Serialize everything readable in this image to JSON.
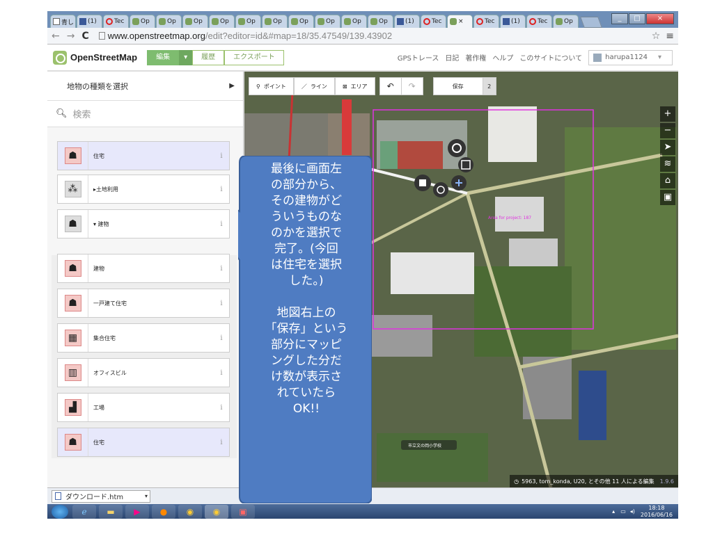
{
  "browser": {
    "tabs": [
      {
        "label": "青し",
        "icon": "doc"
      },
      {
        "label": "(1)",
        "icon": "fb"
      },
      {
        "label": "Tec",
        "icon": "red"
      },
      {
        "label": "Op",
        "icon": "osm"
      },
      {
        "label": "Op",
        "icon": "osm"
      },
      {
        "label": "Op",
        "icon": "osm"
      },
      {
        "label": "Op",
        "icon": "osm"
      },
      {
        "label": "Op",
        "icon": "osm"
      },
      {
        "label": "Op",
        "icon": "osm"
      },
      {
        "label": "Op",
        "icon": "osm"
      },
      {
        "label": "Op",
        "icon": "osm"
      },
      {
        "label": "Op",
        "icon": "osm"
      },
      {
        "label": "Op",
        "icon": "osm"
      },
      {
        "label": "(1)",
        "icon": "fb"
      },
      {
        "label": "Tec",
        "icon": "red"
      },
      {
        "label": "× ",
        "icon": "osm",
        "active": true
      },
      {
        "label": "Tec",
        "icon": "red"
      },
      {
        "label": "(1)",
        "icon": "fb"
      },
      {
        "label": "Tec",
        "icon": "red"
      },
      {
        "label": "Op",
        "icon": "osm"
      }
    ],
    "url_host": "www.openstreetmap.org",
    "url_path": "/edit?editor=id&#map=18/35.47549/139.43902"
  },
  "osm": {
    "brand": "OpenStreetMap",
    "edit": "編集",
    "history": "履歴",
    "export": "エクスポート",
    "links": [
      "GPSトレース",
      "日記",
      "著作権",
      "ヘルプ",
      "このサイトについて"
    ],
    "user": "harupa1124"
  },
  "sidebar": {
    "title": "地物の種類を選択",
    "search_placeholder": "検索",
    "items": [
      {
        "label": "住宅",
        "icon": "house-icon",
        "selected": true
      },
      {
        "label": "▸土地利用",
        "icon": "landuse-icon",
        "gray": true
      },
      {
        "label": "▾ 建物",
        "icon": "house-icon",
        "gray": true
      },
      {
        "label": "建物",
        "icon": "house-icon"
      },
      {
        "label": "一戸建て住宅",
        "icon": "house-icon"
      },
      {
        "label": "集合住宅",
        "icon": "apartment-icon"
      },
      {
        "label": "オフィスビル",
        "icon": "office-icon"
      },
      {
        "label": "工場",
        "icon": "factory-icon"
      },
      {
        "label": "住宅",
        "icon": "house-icon",
        "selected": true
      }
    ],
    "info_glyph": "i"
  },
  "map": {
    "point": "ポイント",
    "line": "ライン",
    "area": "エリア",
    "save": "保存",
    "save_count": "2",
    "controls": [
      "+",
      "−",
      "➤",
      "≋",
      "⌂",
      "▣"
    ],
    "attribution_count": "5963, tom_konda, U20, とその他 11 人による編集",
    "attribution_tail": "1.9.6",
    "label_project": "Area for project: 187",
    "label_school": "市立文の岡小学校"
  },
  "callout": {
    "text": "最後に画面左の部分から、その建物がどういうものなのかを選択で完了。(今回は住宅を選択した。)\n\n地図右上の「保存」という部分にマッピングした分だけ数が表示されていたらOK!!"
  },
  "download": {
    "file": "ダウンロード.htm"
  },
  "taskbar": {
    "time": "18:18",
    "date": "2016/06/16"
  },
  "colors": {
    "osm_green": "#7ebc6f",
    "callout": "#4f7cc2",
    "selection": "#e033e0"
  }
}
